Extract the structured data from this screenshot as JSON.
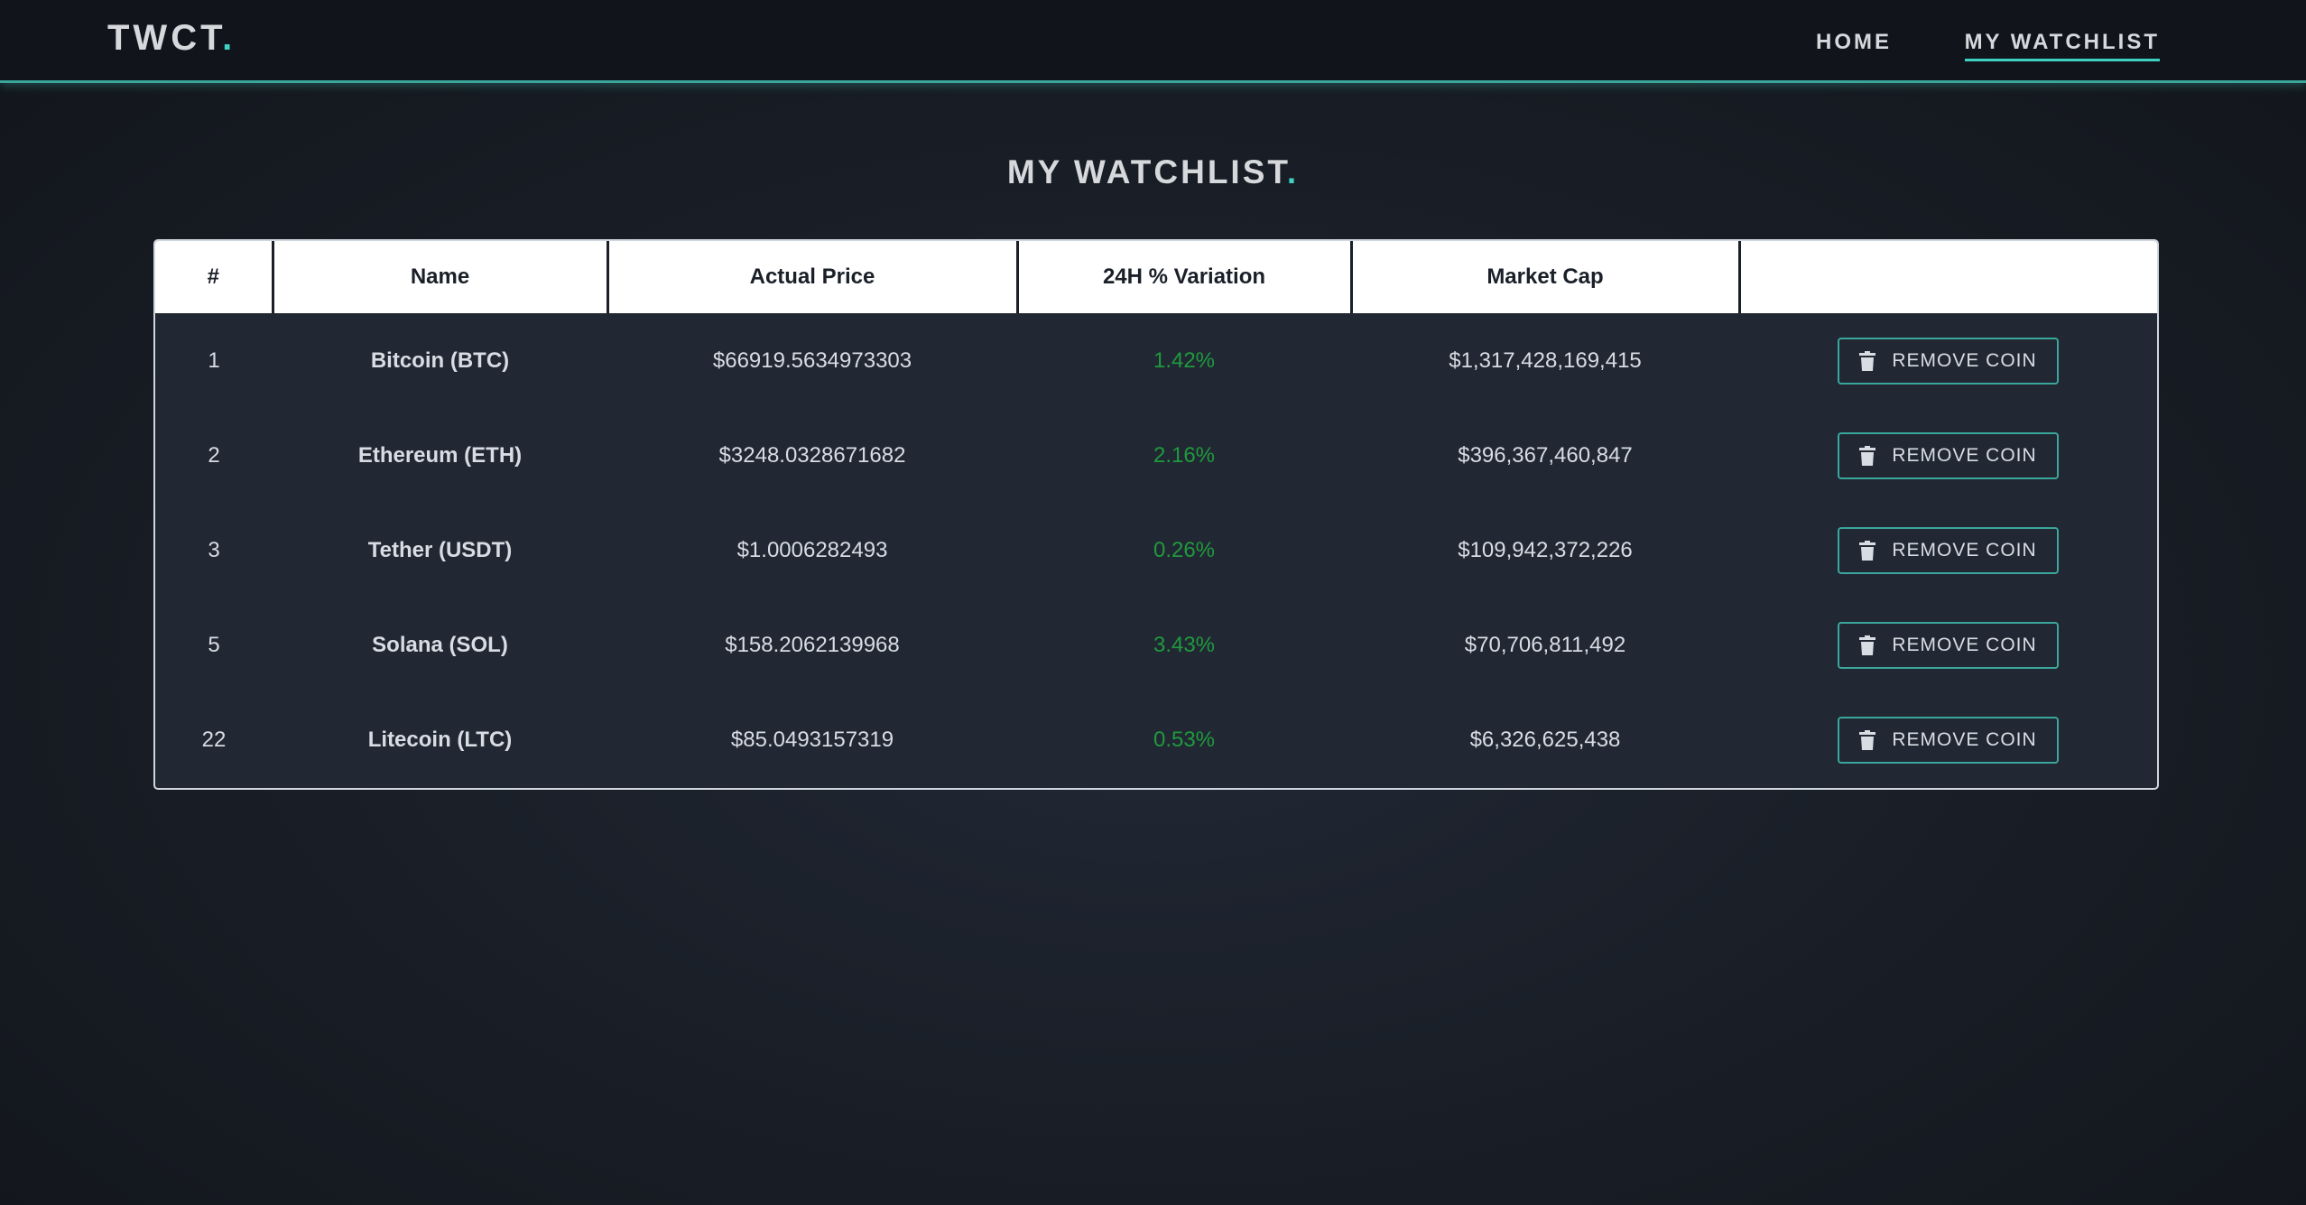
{
  "header": {
    "brand": "TWCT",
    "brand_dot": ".",
    "nav": [
      {
        "label": "HOME"
      },
      {
        "label": "MY WATCHLIST",
        "active": true
      }
    ]
  },
  "page": {
    "title": "MY WATCHLIST",
    "title_dot": "."
  },
  "table": {
    "columns": [
      "#",
      "Name",
      "Actual Price",
      "24H % Variation",
      "Market Cap",
      ""
    ],
    "rows": [
      {
        "rank": "1",
        "name": "Bitcoin (BTC)",
        "price": "$66919.5634973303",
        "change": "1.42%",
        "market_cap": "$1,317,428,169,415",
        "action": "REMOVE COIN"
      },
      {
        "rank": "2",
        "name": "Ethereum (ETH)",
        "price": "$3248.0328671682",
        "change": "2.16%",
        "market_cap": "$396,367,460,847",
        "action": "REMOVE COIN"
      },
      {
        "rank": "3",
        "name": "Tether (USDT)",
        "price": "$1.0006282493",
        "change": "0.26%",
        "market_cap": "$109,942,372,226",
        "action": "REMOVE COIN"
      },
      {
        "rank": "5",
        "name": "Solana (SOL)",
        "price": "$158.2062139968",
        "change": "3.43%",
        "market_cap": "$70,706,811,492",
        "action": "REMOVE COIN"
      },
      {
        "rank": "22",
        "name": "Litecoin (LTC)",
        "price": "$85.0493157319",
        "change": "0.53%",
        "market_cap": "$6,326,625,438",
        "action": "REMOVE COIN"
      }
    ]
  },
  "icons": {
    "remove_button_icon": "trash-icon"
  },
  "colors": {
    "accent": "#3fd0c4",
    "positive_change": "#1f9a3d",
    "header_bg": "#11151b",
    "table_bg": "#212833"
  }
}
